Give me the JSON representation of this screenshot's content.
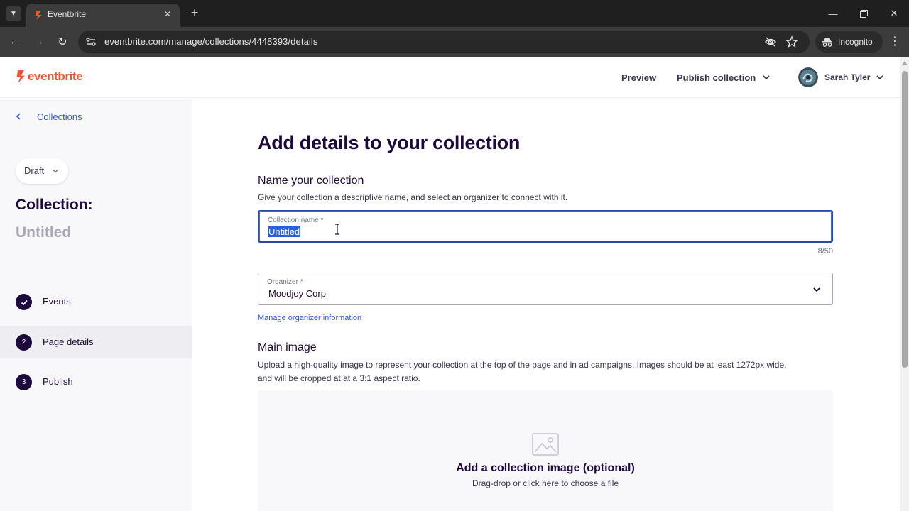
{
  "browser": {
    "tab_title": "Eventbrite",
    "url": "eventbrite.com/manage/collections/4448393/details",
    "incognito_label": "Incognito"
  },
  "header": {
    "logo_text": "eventbrite",
    "preview_label": "Preview",
    "publish_label": "Publish collection",
    "user_name": "Sarah Tyler"
  },
  "sidebar": {
    "back_label": "Collections",
    "status": "Draft",
    "collection_heading": "Collection:",
    "collection_name": "Untitled",
    "steps": [
      {
        "number": "",
        "label": "Events",
        "state": "done"
      },
      {
        "number": "2",
        "label": "Page details",
        "state": "active"
      },
      {
        "number": "3",
        "label": "Publish",
        "state": "pending"
      }
    ]
  },
  "main": {
    "page_title": "Add details to your collection",
    "name_section": {
      "title": "Name your collection",
      "description": "Give your collection a descriptive name, and select an organizer to connect with it.",
      "field_label": "Collection name",
      "required_mark": "*",
      "field_value": "Untitled",
      "char_count": "8/50"
    },
    "organizer": {
      "label": "Organizer",
      "required_mark": "*",
      "value": "Moodjoy Corp",
      "manage_link": "Manage organizer information"
    },
    "image_section": {
      "title": "Main image",
      "description_line1": "Upload a high-quality image to represent your collection at the top of the page and in ad campaigns. Images should be at least 1272px wide,",
      "description_line2": "and will be cropped at at a 3:1 aspect ratio.",
      "dropzone_title": "Add a collection image (optional)",
      "dropzone_subtitle": "Drag-drop or click here to choose a file"
    }
  },
  "colors": {
    "brand": "#f05537",
    "heading": "#1e0a3c",
    "link": "#3659e3",
    "focus": "#3d64ff"
  }
}
